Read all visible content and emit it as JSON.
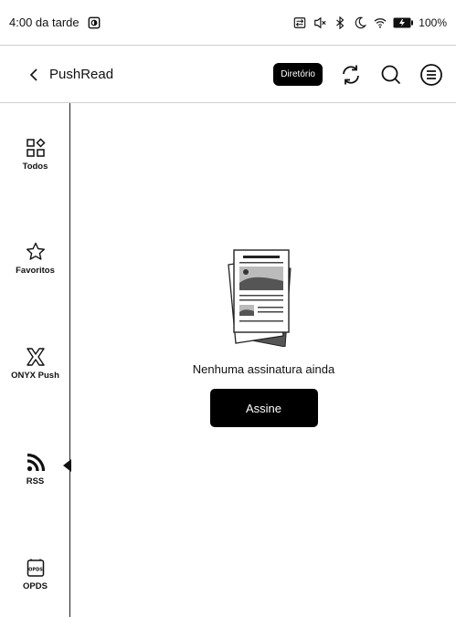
{
  "status_bar": {
    "time": "4:00 da tarde",
    "battery": "100%"
  },
  "header": {
    "back_icon": "chevron-left-icon",
    "title": "PushRead",
    "directory_label": "Diretório",
    "refresh_icon": "refresh-icon",
    "search_icon": "search-icon",
    "menu_icon": "menu-icon"
  },
  "sidebar": {
    "items": [
      {
        "label": "Todos",
        "icon": "grid-icon"
      },
      {
        "label": "Favoritos",
        "icon": "star-icon"
      },
      {
        "label": "ONYX Push",
        "icon": "onyx-push-icon"
      },
      {
        "label": "RSS",
        "icon": "rss-icon",
        "selected": true
      },
      {
        "label": "OPDS",
        "icon": "opds-icon"
      }
    ]
  },
  "main": {
    "empty_message": "Nenhuma assinatura ainda",
    "subscribe_label": "Assine"
  }
}
